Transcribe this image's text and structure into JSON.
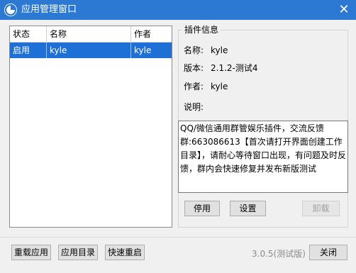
{
  "window": {
    "title": "应用管理窗口",
    "close_glyph": "✕"
  },
  "plugin_list": {
    "columns": [
      "状态",
      "名称",
      "作者"
    ],
    "rows": [
      {
        "status": "启用",
        "name": "kyle",
        "author": "kyle"
      }
    ]
  },
  "plugin_info": {
    "group_title": "插件信息",
    "name_label": "名称:",
    "name_value": "kyle",
    "version_label": "版本:",
    "version_value": "2.1.2-测试4",
    "author_label": "作者:",
    "author_value": "kyle",
    "desc_label": "说明:",
    "description": "QQ/微信通用群管娱乐插件，交流反馈群:663086613【首次请打开界面创建工作目录】，请耐心等待窗口出现，有问题及时反馈，群内会快速修复并发布新版测试"
  },
  "actions": {
    "disable": "停用",
    "settings": "设置",
    "uninstall": "卸载"
  },
  "footer": {
    "reload": "重载应用",
    "app_dir": "应用目录",
    "quick_restart": "快速重启",
    "version": "3.0.5(测试版)",
    "close": "关闭"
  },
  "colors": {
    "titlebar": "#2b79d2",
    "selection": "#1e6fd6"
  }
}
